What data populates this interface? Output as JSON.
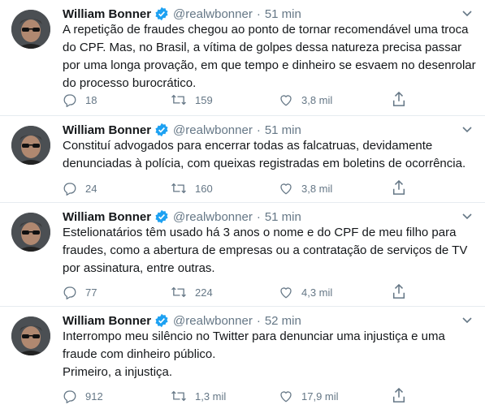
{
  "author": {
    "name": "William Bonner",
    "handle": "@realwbonner",
    "separator": "·"
  },
  "tweets": [
    {
      "time": "51 min",
      "text": "A repetição de fraudes chegou ao ponto de tornar recomendável uma troca do CPF. Mas, no Brasil, a vítima de golpes dessa natureza precisa passar por uma longa provação, em que tempo e dinheiro se esvaem no desenrolar do processo burocrático.",
      "replies": "18",
      "retweets": "159",
      "likes": "3,8 mil"
    },
    {
      "time": "51 min",
      "text": "Constituí advogados para encerrar todas as falcatruas, devidamente denunciadas à polícia, com queixas registradas em boletins de ocorrência.",
      "replies": "24",
      "retweets": "160",
      "likes": "3,8 mil"
    },
    {
      "time": "51 min",
      "text": "Estelionatários têm usado há 3 anos o nome e do CPF de meu filho para fraudes, como a abertura de empresas ou a contratação de  serviços de TV por assinatura, entre outras.",
      "replies": "77",
      "retweets": "224",
      "likes": "4,3 mil"
    },
    {
      "time": "52 min",
      "text": "Interrompo meu silêncio no Twitter para denunciar uma injustiça e uma fraude com dinheiro público.\nPrimeiro, a injustiça.",
      "replies": "912",
      "retweets": "1,3 mil",
      "likes": "17,9 mil"
    }
  ],
  "colors": {
    "accent": "#1da1f2",
    "muted": "#657786",
    "text": "#14171a"
  }
}
